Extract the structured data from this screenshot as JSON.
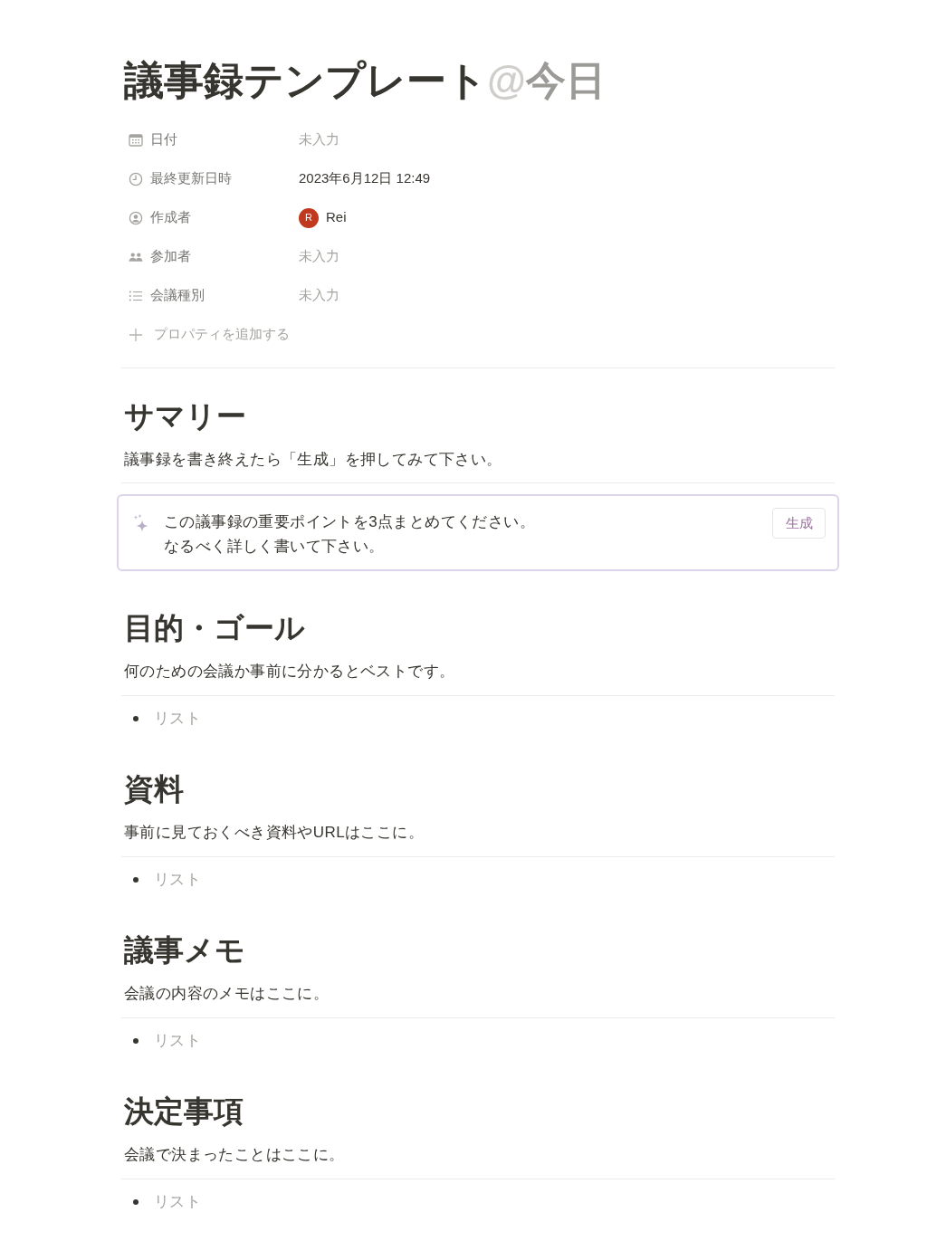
{
  "page": {
    "title": "議事録テンプレート",
    "mention": {
      "symbol": "@",
      "text": "今日"
    }
  },
  "properties": [
    {
      "kind": "date",
      "label": "日付",
      "value": "未入力",
      "empty": true
    },
    {
      "kind": "last_edited_time",
      "label": "最終更新日時",
      "value": "2023年6月12日 12:49",
      "empty": false
    },
    {
      "kind": "person",
      "label": "作成者",
      "value": "Rei",
      "avatar_initial": "R",
      "empty": false
    },
    {
      "kind": "people",
      "label": "参加者",
      "value": "未入力",
      "empty": true
    },
    {
      "kind": "multi_select",
      "label": "会議種別",
      "value": "未入力",
      "empty": true
    }
  ],
  "add_property": "プロパティを追加する",
  "sections": [
    {
      "heading": "サマリー",
      "description": "議事録を書き終えたら「生成」を押してみて下さい。",
      "content": {
        "kind": "ai_block",
        "prompt_lines": [
          "この議事録の重要ポイントを3点まとめてください。",
          "なるべく詳しく書いて下さい。"
        ],
        "button": "生成"
      }
    },
    {
      "heading": "目的・ゴール",
      "description": "何のための会議か事前に分かるとベストです。",
      "content": {
        "kind": "bullet_list",
        "items": [
          {
            "text": "リスト",
            "placeholder": true
          }
        ]
      }
    },
    {
      "heading": "資料",
      "description": "事前に見ておくべき資料やURLはここに。",
      "content": {
        "kind": "bullet_list",
        "items": [
          {
            "text": "リスト",
            "placeholder": true
          }
        ]
      }
    },
    {
      "heading": "議事メモ",
      "description": "会議の内容のメモはここに。",
      "content": {
        "kind": "bullet_list",
        "items": [
          {
            "text": "リスト",
            "placeholder": true
          }
        ]
      }
    },
    {
      "heading": "決定事項",
      "description": "会議で決まったことはここに。",
      "content": {
        "kind": "bullet_list",
        "items": [
          {
            "text": "リスト",
            "placeholder": true
          }
        ]
      }
    }
  ]
}
